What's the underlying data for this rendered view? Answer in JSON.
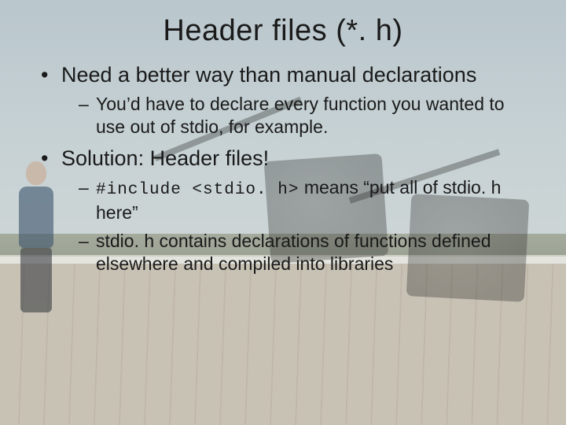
{
  "title": "Header files (*. h)",
  "bullets": [
    {
      "text": "Need a better way than manual declarations",
      "sub": [
        {
          "text": "You’d have to declare every function you wanted to use out of stdio, for example."
        }
      ]
    },
    {
      "text": "Solution: Header files!",
      "sub": [
        {
          "code": "#include <stdio. h>",
          "after": " means “put all of stdio. h here”"
        },
        {
          "text": "stdio. h contains declarations of functions defined elsewhere and compiled into libraries"
        }
      ]
    }
  ]
}
